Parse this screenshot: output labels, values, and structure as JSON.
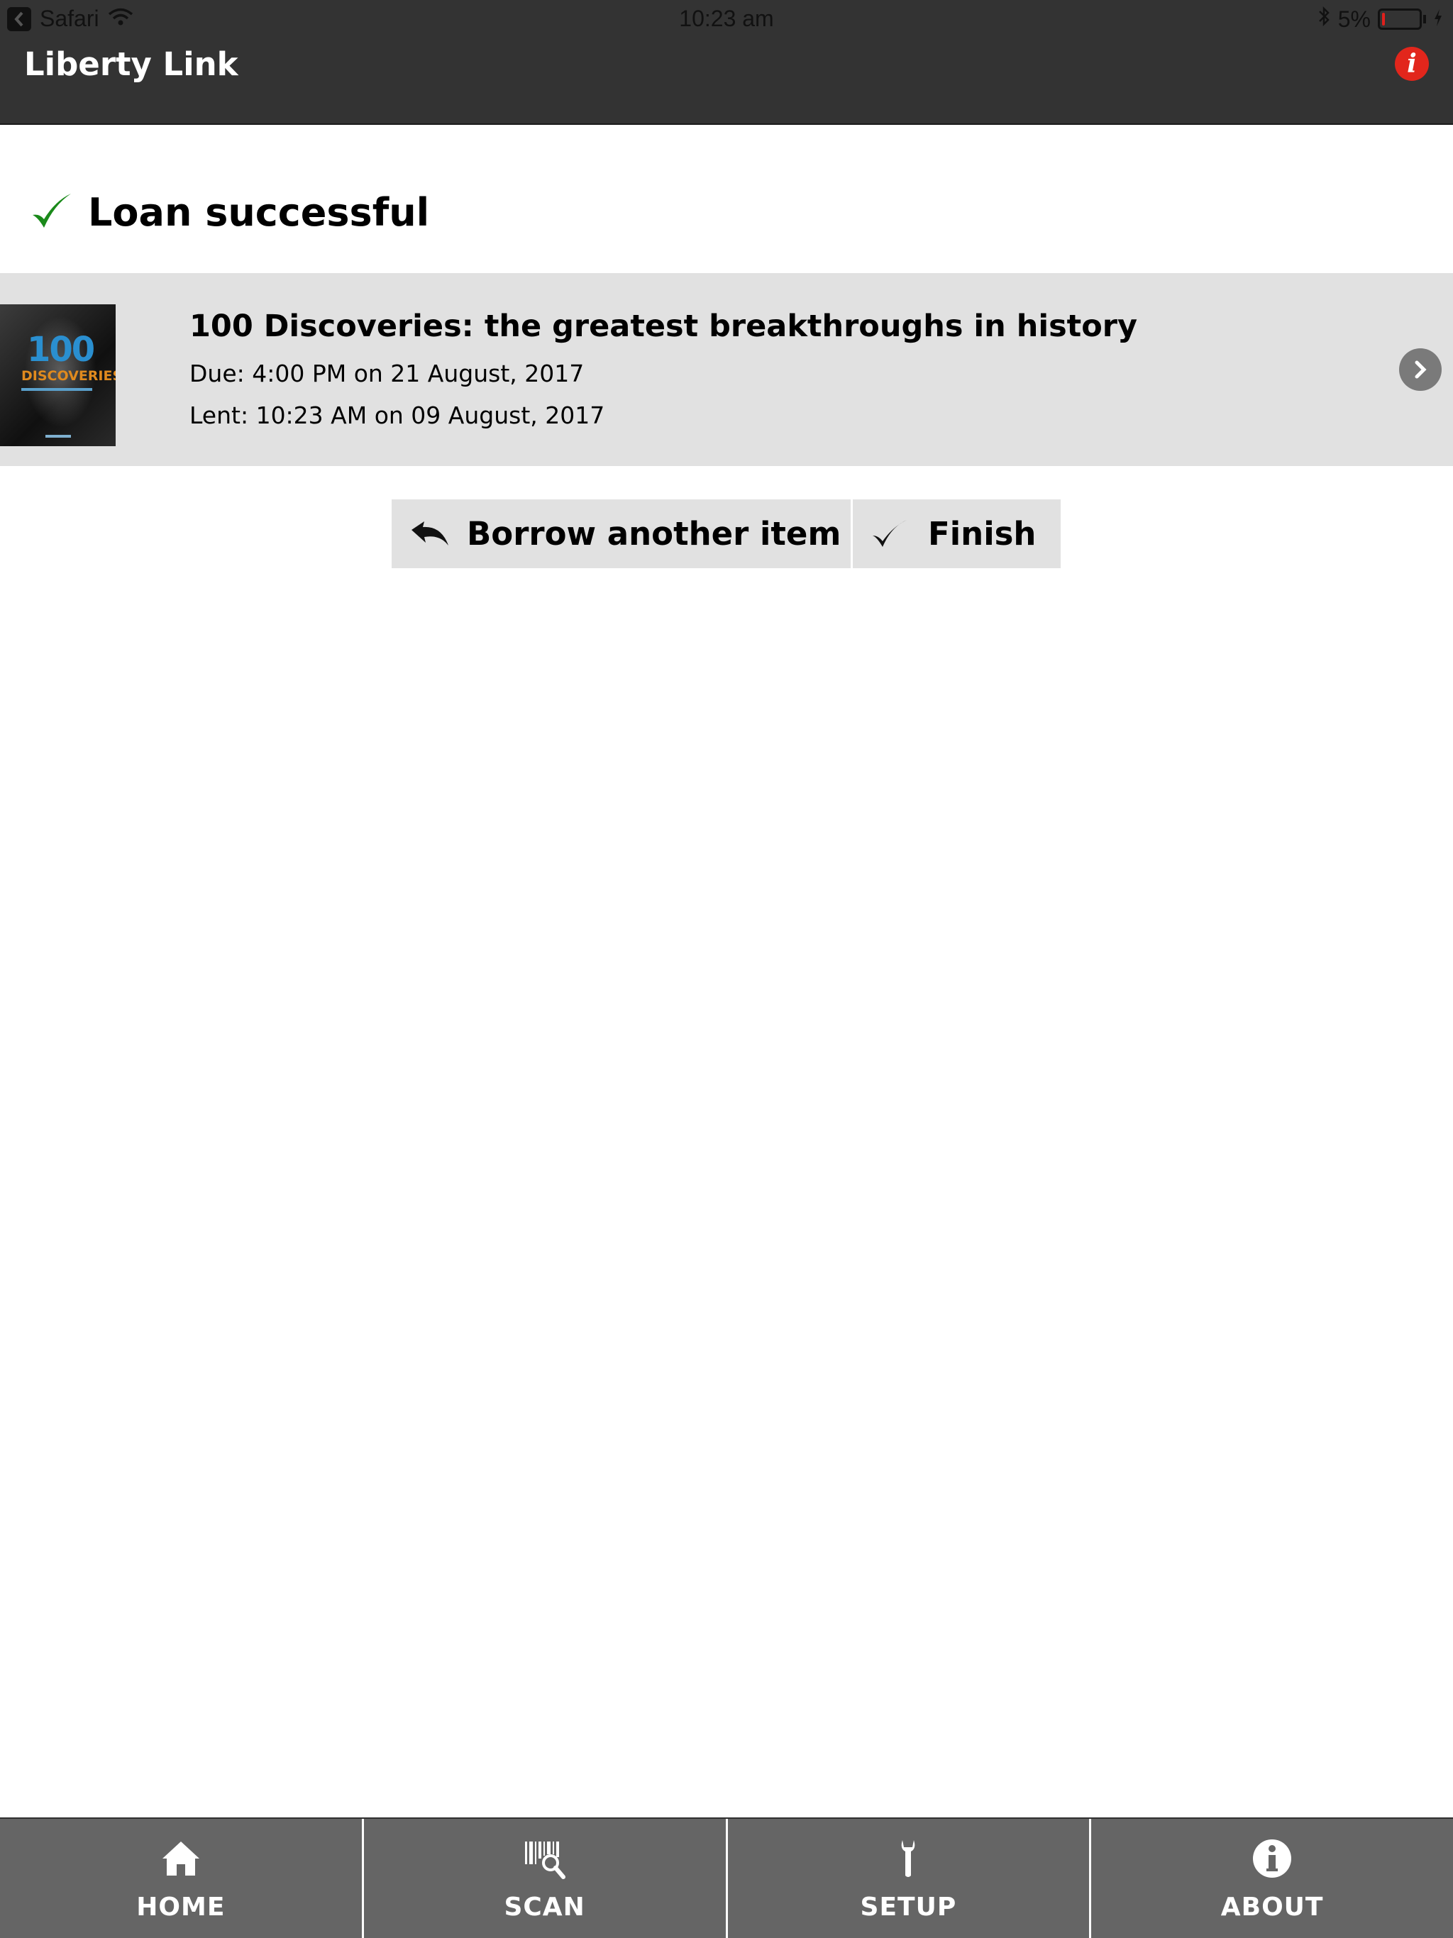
{
  "status_bar": {
    "back_app": "Safari",
    "time": "10:23 am",
    "battery": "5%",
    "battery_level": 0.05
  },
  "header": {
    "title": "Liberty Link"
  },
  "result": {
    "message": "Loan successful"
  },
  "item": {
    "title": "100 Discoveries: the greatest breakthroughs in history",
    "due": "Due: 4:00 PM on 21 August, 2017",
    "lent": "Lent: 10:23 AM on 09 August, 2017",
    "cover": {
      "number": "100",
      "word": "DISCOVERIES"
    }
  },
  "actions": {
    "borrow_label": "Borrow another item",
    "finish_label": "Finish"
  },
  "tabs": [
    {
      "label": "HOME",
      "icon": "home-icon"
    },
    {
      "label": "SCAN",
      "icon": "barcode-scan-icon"
    },
    {
      "label": "SETUP",
      "icon": "wrench-icon"
    },
    {
      "label": "ABOUT",
      "icon": "info-icon"
    }
  ],
  "colors": {
    "header_bg": "#333333",
    "tab_bar_bg": "#656565",
    "row_bg": "#e1e1e1",
    "success_green": "#1a8a1a",
    "info_red": "#e2261c"
  }
}
